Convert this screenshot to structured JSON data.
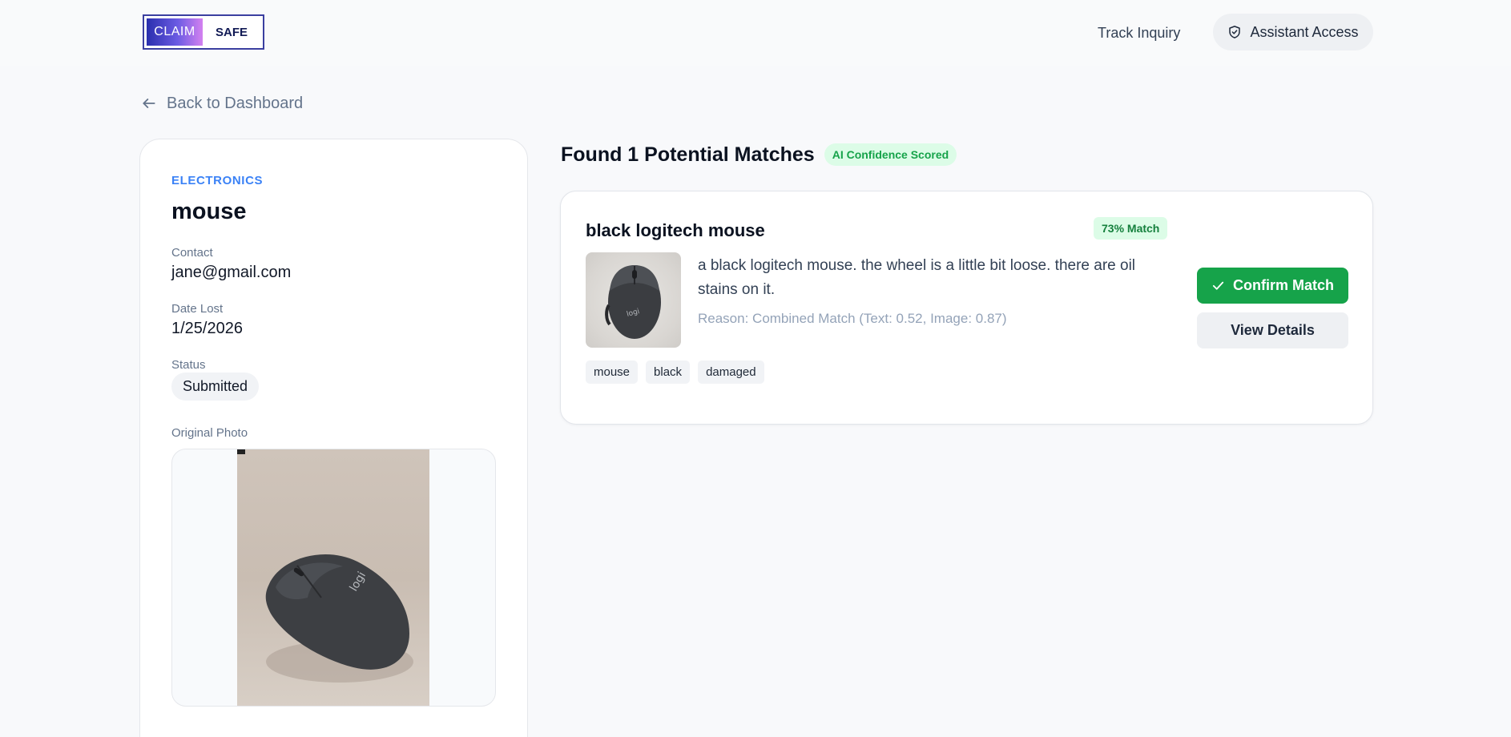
{
  "header": {
    "logo": {
      "left_text": "CLAIM",
      "right_text": "SAFE"
    },
    "track_inquiry_label": "Track Inquiry",
    "assistant_access_label": "Assistant Access"
  },
  "nav": {
    "back_label": "Back to Dashboard"
  },
  "item": {
    "category": "ELECTRONICS",
    "title": "mouse",
    "contact_label": "Contact",
    "contact_value": "jane@gmail.com",
    "date_label": "Date Lost",
    "date_value": "1/25/2026",
    "status_label": "Status",
    "status_value": "Submitted",
    "photo_label": "Original Photo"
  },
  "results": {
    "title": "Found 1 Potential Matches",
    "badge": "AI Confidence Scored",
    "matches": [
      {
        "title": "black logitech mouse",
        "score_label": "73% Match",
        "description": "a black logitech mouse. the wheel is a little bit loose. there are oil stains on it.",
        "reason": "Reason: Combined Match (Text: 0.52, Image: 0.87)",
        "tags": [
          "mouse",
          "black",
          "damaged"
        ],
        "confirm_label": "Confirm Match",
        "details_label": "View Details"
      }
    ]
  },
  "colors": {
    "accent_blue": "#3b82f6",
    "success_green": "#16a34a",
    "badge_green_bg": "#dcfce7",
    "page_bg": "#f8f9fb"
  },
  "icons": {
    "assistant": "shield-check-icon",
    "back": "arrow-left-icon",
    "confirm": "check-icon"
  }
}
